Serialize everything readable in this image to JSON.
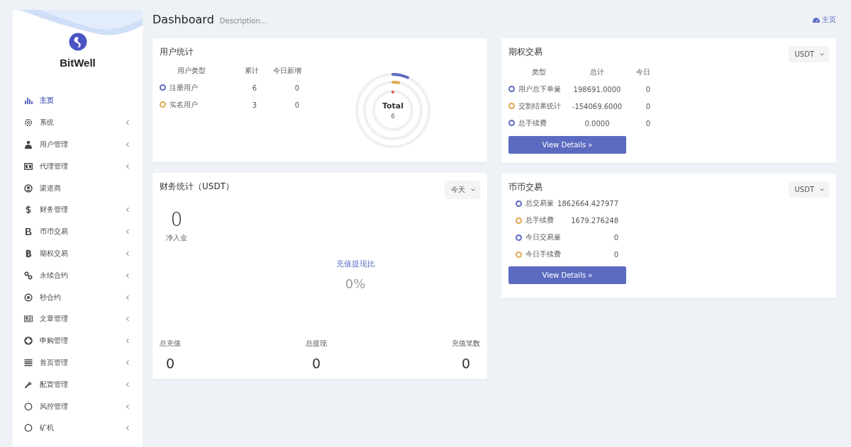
{
  "sidebar": {
    "brand": "BitWell",
    "items": [
      {
        "label": "主页",
        "selected": true,
        "submenu": false
      },
      {
        "label": "系统",
        "selected": false,
        "submenu": true
      },
      {
        "label": "用户管理",
        "selected": false,
        "submenu": true
      },
      {
        "label": "代理管理",
        "selected": false,
        "submenu": true
      },
      {
        "label": "渠道商",
        "selected": false,
        "submenu": false
      },
      {
        "label": "财务管理",
        "selected": false,
        "submenu": true
      },
      {
        "label": "币币交易",
        "selected": false,
        "submenu": true
      },
      {
        "label": "期权交易",
        "selected": false,
        "submenu": true
      },
      {
        "label": "永续合约",
        "selected": false,
        "submenu": true
      },
      {
        "label": "秒合约",
        "selected": false,
        "submenu": true
      },
      {
        "label": "文章管理",
        "selected": false,
        "submenu": true
      },
      {
        "label": "申购管理",
        "selected": false,
        "submenu": true
      },
      {
        "label": "首页管理",
        "selected": false,
        "submenu": true
      },
      {
        "label": "配置管理",
        "selected": false,
        "submenu": true
      },
      {
        "label": "风控管理",
        "selected": false,
        "submenu": true
      },
      {
        "label": "矿机",
        "selected": false,
        "submenu": true
      }
    ]
  },
  "header": {
    "title": "Dashboard",
    "description": "Description...",
    "breadcrumb": "主页"
  },
  "user_stats": {
    "title": "用户统计",
    "columns": [
      "用户类型",
      "累计",
      "今日新增"
    ],
    "rows": [
      {
        "name": "注册用户",
        "total": "6",
        "today": "0",
        "color": "#5c6bc0"
      },
      {
        "name": "实名用户",
        "total": "3",
        "today": "0",
        "color": "#e0a84f"
      }
    ],
    "chart": {
      "label": "Total",
      "value": "6"
    }
  },
  "options_trading": {
    "title": "期权交易",
    "select": "USDT",
    "columns": [
      "类型",
      "总计",
      "今日"
    ],
    "rows": [
      {
        "name": "用户总下单量",
        "total": "198691.0000",
        "today": "0",
        "color": "#5c6bc0"
      },
      {
        "name": "交割结果统计",
        "total": "-154069.6000",
        "today": "0",
        "color": "#e0a84f"
      },
      {
        "name": "总手续费",
        "total": "0.0000",
        "today": "0",
        "color": "#5c6bc0"
      }
    ],
    "button": "View Details »"
  },
  "finance": {
    "title": "财务统计（USDT）",
    "select": "今天",
    "net": {
      "value": "0",
      "label": "净入金"
    },
    "ratio": {
      "label": "充值提现比",
      "value": "0%"
    },
    "stats": [
      {
        "label": "总充值",
        "value": "0"
      },
      {
        "label": "总提现",
        "value": "0"
      },
      {
        "label": "充值笔数",
        "value": "0"
      }
    ]
  },
  "spot_trading": {
    "title": "币币交易",
    "select": "USDT",
    "rows": [
      {
        "name": "总交易量",
        "value": "1862664.427977",
        "color": "#5c6bc0"
      },
      {
        "name": "总手续费",
        "value": "1679.276248",
        "color": "#e0a84f"
      },
      {
        "name": "今日交易量",
        "value": "0",
        "color": "#5c6bc0"
      },
      {
        "name": "今日手续费",
        "value": "0",
        "color": "#e0a84f"
      }
    ],
    "button": "View Details »"
  }
}
